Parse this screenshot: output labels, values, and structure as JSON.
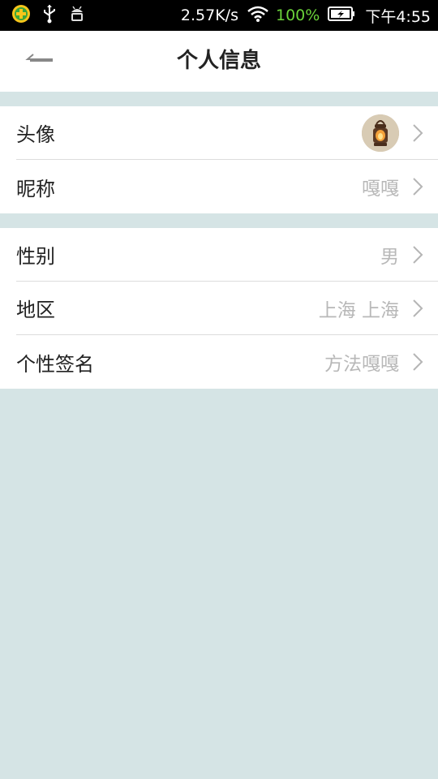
{
  "status_bar": {
    "net_speed": "2.57K/s",
    "battery_percent": "100%",
    "time": "下午4:55",
    "icons": [
      "app-plus-icon",
      "usb-icon",
      "android-debug-icon",
      "wifi-icon",
      "battery-charging-icon"
    ],
    "battery_color": "#6bd33a"
  },
  "header": {
    "title": "个人信息",
    "back_icon": "back-arrow-icon"
  },
  "groups": [
    {
      "rows": [
        {
          "label": "头像",
          "value": "",
          "type": "avatar"
        },
        {
          "label": "昵称",
          "value": "嘎嘎"
        }
      ]
    },
    {
      "rows": [
        {
          "label": "性别",
          "value": "男"
        },
        {
          "label": "地区",
          "value": "上海 上海"
        },
        {
          "label": "个性签名",
          "value": "方法嘎嘎"
        }
      ]
    }
  ],
  "colors": {
    "page_background": "#d5e4e5",
    "value_text": "#b8b8b8"
  }
}
